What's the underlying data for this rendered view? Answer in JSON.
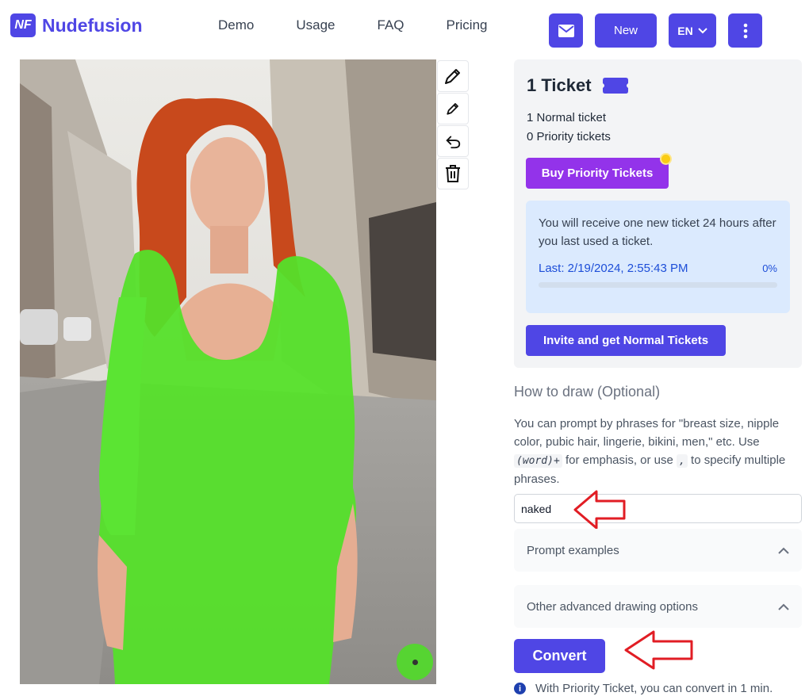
{
  "brand": {
    "logo_badge": "NF",
    "name": "Nudefusion"
  },
  "nav": [
    "Demo",
    "Usage",
    "FAQ",
    "Pricing"
  ],
  "header_buttons": {
    "mail_icon": "mail-icon",
    "new_label": "New",
    "language": "EN",
    "more_icon": "more-vertical-icon"
  },
  "tools": [
    "pencil-large-icon",
    "pencil-small-icon",
    "undo-icon",
    "trash-icon"
  ],
  "ticket": {
    "title": "1 Ticket",
    "normal": "1 Normal ticket",
    "priority": "0 Priority tickets",
    "buy_label": "Buy Priority Tickets",
    "info": "You will receive one new ticket 24 hours after you last used a ticket.",
    "last": "Last: 2/19/2024, 2:55:43 PM",
    "percent": "0%",
    "progress": 0,
    "invite_label": "Invite and get Normal Tickets"
  },
  "draw": {
    "title": "How to draw (Optional)",
    "help_1": "You can prompt by phrases for \"breast size, nipple color, pubic hair, lingerie, bikini, men,\" etc. Use ",
    "help_code": "(word)+",
    "help_2": " for emphasis, or use ",
    "help_comma": ",",
    "help_3": " to specify multiple phrases.",
    "prompt_value": "naked"
  },
  "accordions": {
    "examples": "Prompt examples",
    "advanced": "Other advanced drawing options"
  },
  "convert_label": "Convert",
  "note": "With Priority Ticket, you can convert in 1 min.",
  "colors": {
    "primary": "#4f46e5",
    "purple": "#9333ea",
    "mask": "#55e02a",
    "arrow": "#e11d24"
  }
}
